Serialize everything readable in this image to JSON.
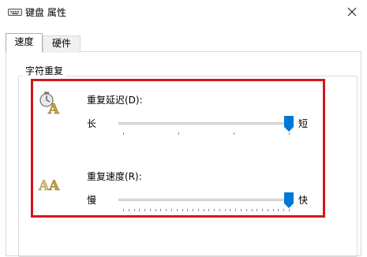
{
  "window": {
    "title": "键盘 属性",
    "title_icon": "keyboard-icon",
    "close_glyph": "✕"
  },
  "tabs": [
    {
      "label": "速度",
      "selected": true
    },
    {
      "label": "硬件",
      "selected": false
    }
  ],
  "group": {
    "label": "字符重复",
    "repeat_delay": {
      "label": "重复延迟(D):",
      "min_label": "长",
      "max_label": "短",
      "icon": "clock-letter-a-icon",
      "value": 3,
      "max": 3
    },
    "repeat_rate": {
      "label": "重复速度(R):",
      "min_label": "慢",
      "max_label": "快",
      "icon": "double-letter-a-icon",
      "value": 31,
      "max": 31
    }
  },
  "highlight_color": "#d4151c",
  "accent_color": "#0078d7"
}
